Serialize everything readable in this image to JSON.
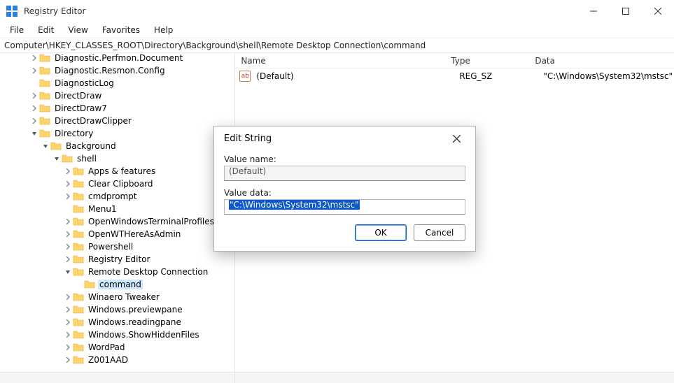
{
  "window": {
    "title": "Registry Editor",
    "controls": {
      "minimize": "–",
      "maximize": "□",
      "close": "✕"
    }
  },
  "menubar": [
    "File",
    "Edit",
    "View",
    "Favorites",
    "Help"
  ],
  "addressbar": "Computer\\HKEY_CLASSES_ROOT\\Directory\\Background\\shell\\Remote Desktop Connection\\command",
  "tree": [
    {
      "depth": 2,
      "chev": "r",
      "label": "Diagnostic.Perfmon.Document"
    },
    {
      "depth": 2,
      "chev": "r",
      "label": "Diagnostic.Resmon.Config"
    },
    {
      "depth": 2,
      "chev": "",
      "label": "DiagnosticLog"
    },
    {
      "depth": 2,
      "chev": "r",
      "label": "DirectDraw"
    },
    {
      "depth": 2,
      "chev": "r",
      "label": "DirectDraw7"
    },
    {
      "depth": 2,
      "chev": "r",
      "label": "DirectDrawClipper"
    },
    {
      "depth": 2,
      "chev": "d",
      "label": "Directory"
    },
    {
      "depth": 3,
      "chev": "d",
      "label": "Background"
    },
    {
      "depth": 4,
      "chev": "d",
      "label": "shell"
    },
    {
      "depth": 5,
      "chev": "r",
      "label": "Apps & features"
    },
    {
      "depth": 5,
      "chev": "r",
      "label": "Clear Clipboard"
    },
    {
      "depth": 5,
      "chev": "r",
      "label": "cmdprompt"
    },
    {
      "depth": 5,
      "chev": "",
      "label": "Menu1"
    },
    {
      "depth": 5,
      "chev": "r",
      "label": "OpenWindowsTerminalProfiles"
    },
    {
      "depth": 5,
      "chev": "r",
      "label": "OpenWTHereAsAdmin"
    },
    {
      "depth": 5,
      "chev": "r",
      "label": "Powershell"
    },
    {
      "depth": 5,
      "chev": "r",
      "label": "Registry Editor"
    },
    {
      "depth": 5,
      "chev": "d",
      "label": "Remote Desktop Connection"
    },
    {
      "depth": 6,
      "chev": "",
      "label": "command",
      "selected": true
    },
    {
      "depth": 5,
      "chev": "r",
      "label": "Winaero Tweaker"
    },
    {
      "depth": 5,
      "chev": "r",
      "label": "Windows.previewpane"
    },
    {
      "depth": 5,
      "chev": "r",
      "label": "Windows.readingpane"
    },
    {
      "depth": 5,
      "chev": "r",
      "label": "Windows.ShowHiddenFiles"
    },
    {
      "depth": 5,
      "chev": "r",
      "label": "WordPad"
    },
    {
      "depth": 5,
      "chev": "r",
      "label": "Z001AAD"
    }
  ],
  "value_cols": {
    "name": "Name",
    "type": "Type",
    "data": "Data"
  },
  "value_rows": [
    {
      "icon": "ab",
      "name": "(Default)",
      "type": "REG_SZ",
      "data": "\"C:\\Windows\\System32\\mstsc\""
    }
  ],
  "dialog": {
    "title": "Edit String",
    "name_label": "Value name:",
    "name_value": "(Default)",
    "data_label": "Value data:",
    "data_value": "\"C:\\Windows\\System32\\mstsc\"",
    "ok": "OK",
    "cancel": "Cancel"
  }
}
